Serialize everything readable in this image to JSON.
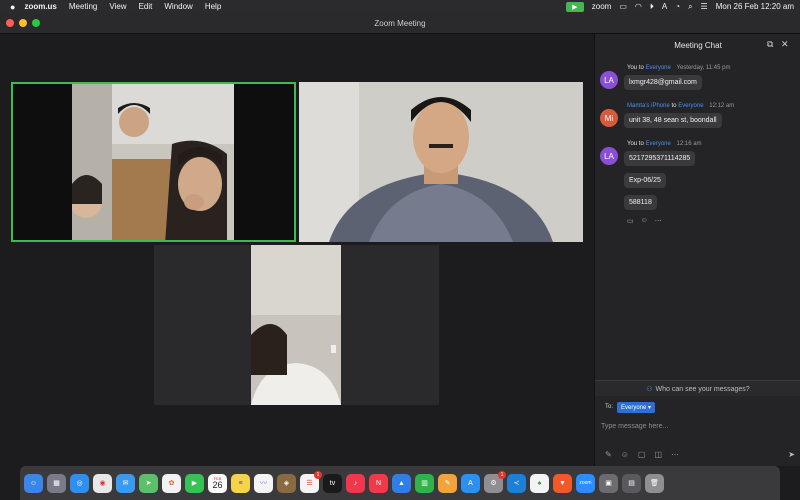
{
  "menubar": {
    "app": "zoom.us",
    "items": [
      "Meeting",
      "View",
      "Edit",
      "Window",
      "Help"
    ],
    "zoom_word": "zoom",
    "datetime": "Mon 26 Feb  12:20 am"
  },
  "window": {
    "title": "Zoom Meeting"
  },
  "chat": {
    "header": "Meeting Chat",
    "messages": [
      {
        "initials": "LA",
        "avatar_color": "#8a4fd6",
        "sender": "You",
        "to_word": "to",
        "recipient": "Everyone",
        "time": "Yesterday, 11:45 pm",
        "bubbles": [
          "lxmgr428@gmail.com"
        ]
      },
      {
        "initials": "Mi",
        "avatar_color": "#d65a3c",
        "sender": "Mamta's iPhone",
        "to_word": "to",
        "recipient": "Everyone",
        "time": "12:12 am",
        "bubbles": [
          "unit 38, 48 sean st, boondall"
        ]
      },
      {
        "initials": "LA",
        "avatar_color": "#8a4fd6",
        "sender": "You",
        "to_word": "to",
        "recipient": "Everyone",
        "time": "12:16 am",
        "bubbles": [
          "5217295371114285",
          "Exp-06/25",
          "588118"
        ]
      }
    ],
    "who_can_see": "Who can see your messages?",
    "composer": {
      "to_label": "To:",
      "recipient": "Everyone",
      "placeholder": "Type message here..."
    }
  },
  "dock": {
    "calendar_month": "FEB",
    "calendar_day": "26",
    "reminders_badge": "1",
    "settings_badge": "1",
    "zoom_label": "zoom",
    "apps": [
      "finder-icon",
      "launchpad-icon",
      "safari-icon",
      "chrome-icon",
      "mail-icon",
      "maps-icon",
      "photos-icon",
      "facetime-icon",
      "calendar-icon",
      "notes-icon",
      "freeform-icon",
      "keka-icon",
      "reminders-icon",
      "appletv-icon",
      "music-icon",
      "news-icon",
      "keynote-icon",
      "numbers-icon",
      "pages-icon",
      "appstore-icon",
      "settings-icon",
      "vscode-icon",
      "mongodb-icon",
      "brave-icon",
      "zoom-icon",
      "screenshot-icon",
      "preview-icon",
      "trash-icon"
    ]
  },
  "colors": {
    "active_speaker": "#3fb950",
    "link_blue": "#4a90f0",
    "everyone_button": "#2d6fd6"
  }
}
